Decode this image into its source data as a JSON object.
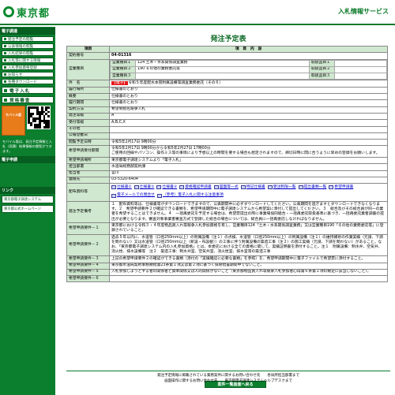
{
  "header": {
    "logo_text": "東京都",
    "service": "入札情報サービス"
  },
  "side": {
    "menu_head": "電子調達",
    "menu": [
      "発注予定の閲覧",
      "公表情報の閲覧",
      "入札結果の閲覧",
      "入札等に関する情報",
      "入札参加資格登録",
      "お知らせ",
      "各種ダウンロード"
    ],
    "big": [
      "電子入札",
      "資格審査"
    ],
    "mobile_label": "モバイル版",
    "mobile_text": "モバイル版は、発注予定情報と入札（見積）結果情報の閲覧ができます。",
    "link_head": "リンク",
    "links": [
      "東京都電子調達システム",
      "東京都公式ホームページ"
    ],
    "ext_head": "電子申請"
  },
  "page": {
    "title": "発注予定表",
    "col_item": "項目",
    "col_content": "項　目　内　容",
    "rows": [
      {
        "k": "契約番号",
        "v": "04-01316"
      },
      {
        "k": "件　名",
        "v": "令和５年度配水本管附属設備等調査業務委託（その６）"
      },
      {
        "k": "履行場所",
        "v": "仕様書のとおり"
      },
      {
        "k": "概要",
        "v": "仕様書のとおり"
      },
      {
        "k": "履行期間",
        "v": "仕様書のとおり"
      },
      {
        "k": "契約方法",
        "v": "希望制指名競争入札"
      },
      {
        "k": "発注等級",
        "v": "A"
      },
      {
        "k": "受付等級",
        "v": "A,B,C,X"
      },
      {
        "k": "その他",
        "v": ""
      },
      {
        "k": "公報登載日",
        "v": ""
      },
      {
        "k": "閲覧予定日時",
        "v": "令和5年2月17日 9時00分"
      },
      {
        "k": "希望申請受付期間",
        "v": "令和5年2月17日 9時00分から令和5年2月27日 17時00分"
      }
    ],
    "badge": "【電子】",
    "gyomu": [
      {
        "label": "営業種目１",
        "v": "124 土木・水系関係調査業務",
        "rank_label": "取扱品目１",
        "rank": ""
      },
      {
        "label": "営業種目２",
        "v": "190 その他の業務委託等",
        "rank_label": "取扱品目２",
        "rank": ""
      },
      {
        "label": "営業種目３",
        "v": "",
        "rank_label": "取扱品目３",
        "rank": ""
      }
    ],
    "kiboh_note": "ご使用の回線やパソコン、操作ミス等の事情により予想以上の時間を要する場合も想定されますので、締切日時に間に合うように早めの登録をお願いします。",
    "rows2": [
      {
        "k": "希望申請場所",
        "v": "東京都電子調達システムより「電子入札」"
      },
      {
        "k": "担当部署",
        "v": "水道局総務部契約課"
      },
      {
        "k": "担当者",
        "v": "宮川"
      },
      {
        "k": "連絡先",
        "v": "03-5320-6404"
      }
    ],
    "docs_label": "配布資料等",
    "docs": [
      "仕様書①",
      "仕様書②",
      "仕様書③",
      "資格確認申請書",
      "図面等一式",
      "特記仕様書",
      "受注制限一覧",
      "提出書類一覧",
      "希望申請書",
      "電子メールでの問合せ",
      "（参考）電子入札に関する注意事項"
    ],
    "bikou_label": "発注予定備考",
    "bikou": "１　配布資料等は、仕様書等がダウンロードできますので、公表期間中に必ずダウンロードしてください。公表期間を過ぎますとダウンロードできなくなります。２　希望申請要件２が確認できる書類を、希望申請期間中に電子調達システムから希望案に添付して提出してください。３　総合及びその総合員が同一の業者を希望することはできません。４　一括再委託を予定する場合は、希望票提出の際に事業場協同組合・一括再委託取扱基準に基づき、一括再委託業者調書の提出が必要となります。審査対象事業者審査方式で登録した総合の場合については、総合員に一括再委託しなければなりません。",
    "req_label": "希望申請要件",
    "reqs": [
      {
        "k": "希望申請要件－１",
        "v": "東京都における令和３・４年度物品買入れ等競争入札参加資格を有し、営業種目124「土木・水系関係調査業務」又は営業種目190「その他の業務委託等」に登録されていること。"
      },
      {
        "k": "希望申請要件－２",
        "v": "過去５年以内に、水道管（口径250mm以上）の附属設備（注１）の点検、水道管（口径250mm以上）の附属設備（注１）の維持補修の作業実績（元請、下請を問わない）又は水道管（口径250mm以上（新設・布設替））の工事に伴う附属設備の築造工事（注２）の施工実績（元請、下請を問わない）があること。なお、「東京都電子調達システム内の入札参加資格」とは、本委託における全ての資格に関して、実績証明書を添付すること。注１　附属設備：制水弁、空気弁、消火栓、排水設備等　注２　築造工事：制水弁室、空気弁室、消火栓室、排水室等の築造工事"
      },
      {
        "k": "希望申請要件－３",
        "v": "上記の希望申請要件２の確認ができる書類（添付の「実績確認に必要な書類」を参照）を、希望申請期間中に電子ファイルで希望票に添付すること。"
      },
      {
        "k": "希望申請要件－４",
        "v": "東京都水道局契約事務規程第23条第１項又は第２項に基づく排除措置期間中でないこと。"
      },
      {
        "k": "希望申請要件－５",
        "v": "入札参加しようとする者の関係者と資本関係又は人的関係がないこと（東京都物品買入れ等競争入札参加者心得第６条第１項の規定に該当しないこと）。"
      },
      {
        "k": "希望申請要件－６",
        "v": ""
      }
    ],
    "back_btn": "案件一覧画面へ戻る"
  },
  "footer": {
    "line1": "発注予定情報に掲載されている業務案件に関するお問い合わせ先　　各局所担当部署まで",
    "line2": "画面操作に関するお問い合わせ先　　東京都電子調達システムヘルプデスクまで"
  }
}
